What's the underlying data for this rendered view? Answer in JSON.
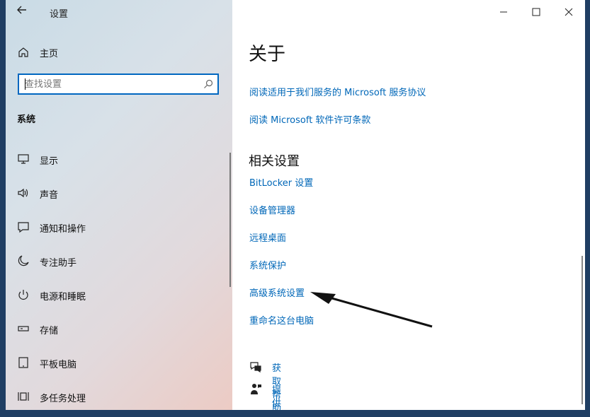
{
  "window": {
    "title": "设置"
  },
  "sidebar": {
    "home_label": "主页",
    "search_placeholder": "查找设置",
    "section_heading": "系统",
    "items": [
      {
        "label": "显示",
        "icon": "monitor-icon"
      },
      {
        "label": "声音",
        "icon": "speaker-icon"
      },
      {
        "label": "通知和操作",
        "icon": "notification-icon"
      },
      {
        "label": "专注助手",
        "icon": "moon-icon"
      },
      {
        "label": "电源和睡眠",
        "icon": "power-icon"
      },
      {
        "label": "存储",
        "icon": "storage-icon"
      },
      {
        "label": "平板电脑",
        "icon": "tablet-icon"
      },
      {
        "label": "多任务处理",
        "icon": "multitask-icon"
      }
    ]
  },
  "main": {
    "title": "关于",
    "links": [
      "阅读适用于我们服务的 Microsoft 服务协议",
      "阅读 Microsoft 软件许可条款"
    ],
    "related_title": "相关设置",
    "related_links": [
      "BitLocker 设置",
      "设备管理器",
      "远程桌面",
      "系统保护",
      "高级系统设置",
      "重命名这台电脑"
    ],
    "help": {
      "get_help": "获取帮助",
      "feedback": "提供反馈"
    }
  },
  "colors": {
    "accent": "#0067c0",
    "link": "#0067b8"
  }
}
